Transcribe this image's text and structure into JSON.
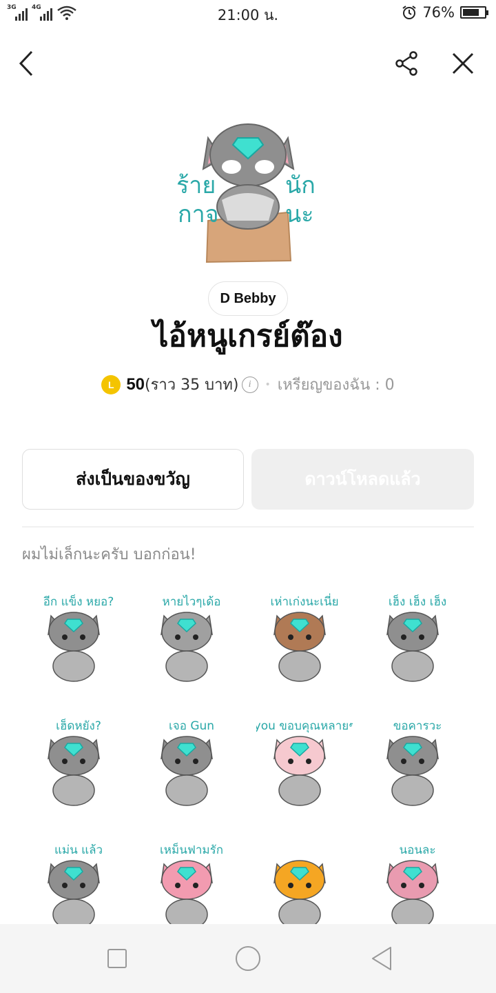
{
  "status_bar": {
    "signal_1_label": "3G",
    "signal_2_label": "4G",
    "time": "21:00 น.",
    "battery_percent": "76%",
    "battery_level": 0.76,
    "icons": [
      "signal-icon",
      "wifi-icon",
      "alarm-icon",
      "battery-icon"
    ]
  },
  "top_nav": {
    "icons": [
      "back-arrow-icon",
      "share-icon",
      "close-icon"
    ]
  },
  "pack": {
    "author": "D Bebby",
    "title": "ไอ้หนูเกรย์ต๊อง",
    "coin_badge": "L",
    "price": "50",
    "price_approx": "(ราว 35 บาท)",
    "info_symbol": "i",
    "separator": "•",
    "coins_owned": "เหรียญของฉัน : 0",
    "description": "ผมไม่เล็กนะครับ บอกก่อน!"
  },
  "buttons": {
    "gift_label": "ส่งเป็นของขวัญ",
    "download_label": "ดาวน์โหลดแล้ว"
  },
  "hero_sticker": {
    "caption_left": [
      "ร้าย",
      "กาจ"
    ],
    "caption_right": [
      "นัก",
      "นะ"
    ]
  },
  "stickers": [
    {
      "caption": "อีก แข็ง หยอ?"
    },
    {
      "caption": "หายไวๆเด้อ"
    },
    {
      "caption": "เห่าเก่งนะเนี่ย"
    },
    {
      "caption": "เฮ็ง เฮ็ง เฮ็ง"
    },
    {
      "caption": "เฮ็ดหยัง?"
    },
    {
      "caption": "เจอ Gun"
    },
    {
      "caption": "you ขอบคุณหลายๆ"
    },
    {
      "caption": "ขอคารวะ"
    },
    {
      "caption": "แม่น แล้ว"
    },
    {
      "caption": "เหม็นฟามรัก"
    },
    {
      "caption": ""
    },
    {
      "caption": "นอนละ"
    }
  ],
  "colors": {
    "accent_teal": "#2aa8a8",
    "coin_yellow": "#f4c400",
    "cat_gray": "#8f8f8f",
    "gem_cyan": "#3fe0d0"
  },
  "nav_bar": {
    "icons": [
      "recent-apps-icon",
      "home-icon",
      "back-icon"
    ]
  }
}
